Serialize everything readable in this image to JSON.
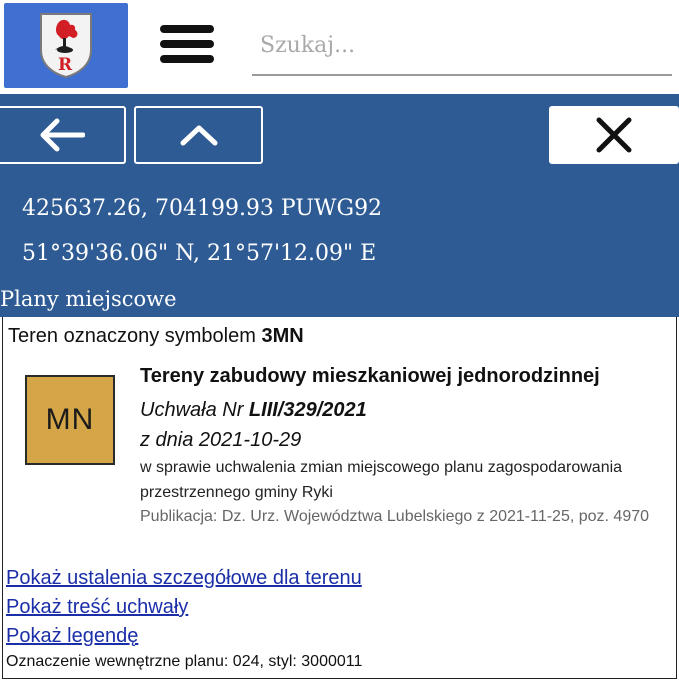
{
  "header": {
    "search_placeholder": "Szukaj..."
  },
  "icons": {
    "logo": "coat-of-arms-icon",
    "menu": "hamburger-menu-icon",
    "back": "arrow-left-icon",
    "up": "chevron-up-icon",
    "close": "close-icon"
  },
  "colors": {
    "logo_bg": "#3e6fd1",
    "panel_bg": "#2e5b94",
    "zone_mn": "#d4a648",
    "link": "#1a2ea8"
  },
  "location": {
    "coords_puwg": "425637.26, 704199.93 PUWG92",
    "coords_wgs": "51°39'36.06\" N, 21°57'12.09\" E"
  },
  "section_title": "Plany miejscowe",
  "card": {
    "header_prefix": "Teren oznaczony symbolem ",
    "symbol": "3MN",
    "badge": "MN",
    "area_title": "Tereny zabudowy mieszkaniowej jednorodzinnej",
    "resolution_prefix": "Uchwała Nr ",
    "resolution_number": "LIII/329/2021",
    "resolution_date": "z dnia 2021-10-29",
    "description": "w sprawie uchwalenia zmian miejscowego planu zagospodarowania przestrzennego gminy Ryki",
    "publication": "Publikacja: Dz. Urz. Województwa Lubelskiego z 2021-11-25, poz. 4970",
    "links": [
      "Pokaż ustalenia szczegółowe dla terenu",
      "Pokaż treść uchwały",
      "Pokaż legendę"
    ],
    "internal_designation": "Oznaczenie wewnętrzne planu: 024, styl: 3000011"
  }
}
